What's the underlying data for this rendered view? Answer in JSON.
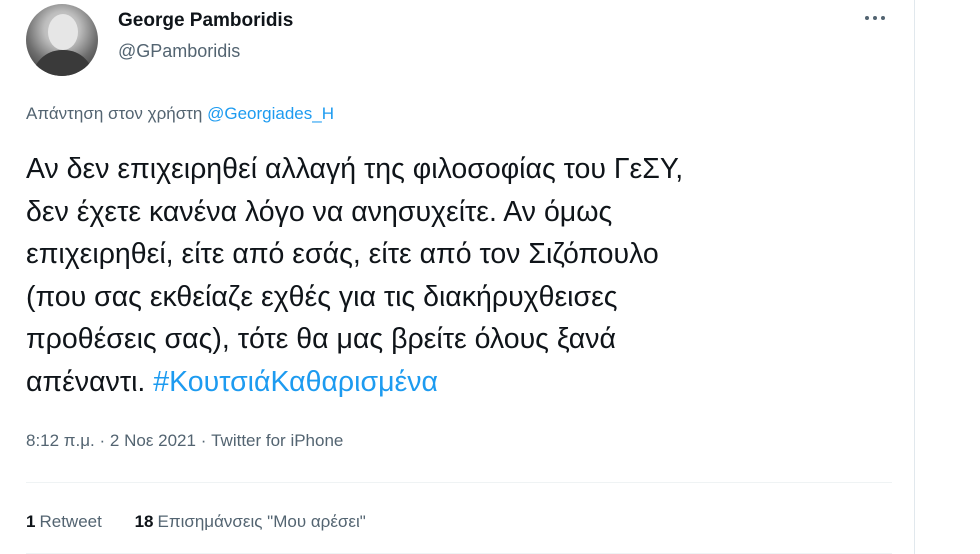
{
  "author": {
    "display_name": "George Pamboridis",
    "handle": "@GPamboridis"
  },
  "more_icon": "more-horizontal-icon",
  "reply_context": {
    "prefix": "Απάντηση στον χρήστη",
    "mention": "@Georgiades_H"
  },
  "tweet": {
    "lines": [
      "Αν δεν επιχειρηθεί αλλαγή της φιλοσοφίας του ΓεΣΥ,",
      "δεν έχετε κανένα λόγο να ανησυχείτε. Αν όμως",
      "επιχειρηθεί, είτε από εσάς, είτε από τον Σιζόπουλο",
      "(που σας εκθείαζε εχθές για τις διακήρυχθεισες",
      "προθέσεις σας), τότε θα μας βρείτε όλους ξανά",
      "απέναντι."
    ],
    "hashtag": "#ΚουτσιάΚαθαρισμένα"
  },
  "meta": {
    "time": "8:12 π.μ.",
    "separator": "·",
    "date": "2 Νοε 2021",
    "source": "Twitter for iPhone"
  },
  "stats": {
    "retweets_count": "1",
    "retweets_label": "Retweet",
    "likes_count": "18",
    "likes_label": "Επισημάνσεις \"Μου αρέσει\""
  },
  "colors": {
    "link": "#1d9bf0",
    "secondary_text": "#536471",
    "primary_text": "#0f1419"
  }
}
